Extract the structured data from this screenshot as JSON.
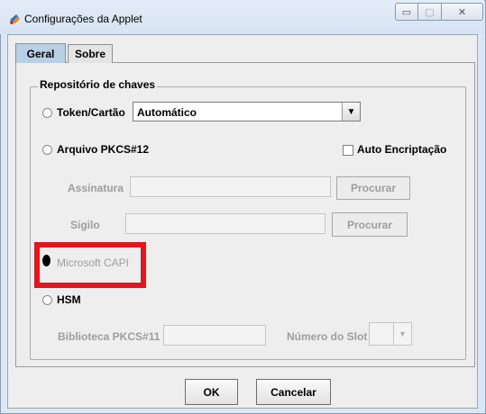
{
  "window": {
    "title": "Configurações da Applet",
    "buttons": {
      "minimize": "▭",
      "maximize": "▢",
      "close": "✕"
    }
  },
  "tabs": [
    {
      "label": "Geral",
      "active": true
    },
    {
      "label": "Sobre",
      "active": false
    }
  ],
  "keystore": {
    "group_title": "Repositório de chaves",
    "token": {
      "label": "Token/Cartão",
      "selected_value": "Automático"
    },
    "pkcs12": {
      "label": "Arquivo PKCS#12",
      "auto_encrypt_label": "Auto Encriptação",
      "assinatura_label": "Assinatura",
      "sigilo_label": "Sigilo",
      "browse_label": "Procurar"
    },
    "capi": {
      "label": "Microsoft CAPI"
    },
    "hsm": {
      "label": "HSM",
      "lib_label": "Biblioteca PKCS#11",
      "slot_label": "Número do Slot"
    }
  },
  "footer": {
    "ok_label": "OK",
    "cancel_label": "Cancelar"
  },
  "colors": {
    "highlight": "#e3151d",
    "active_tab": "#b8cfe5",
    "disabled_text": "#9d9d9d"
  }
}
